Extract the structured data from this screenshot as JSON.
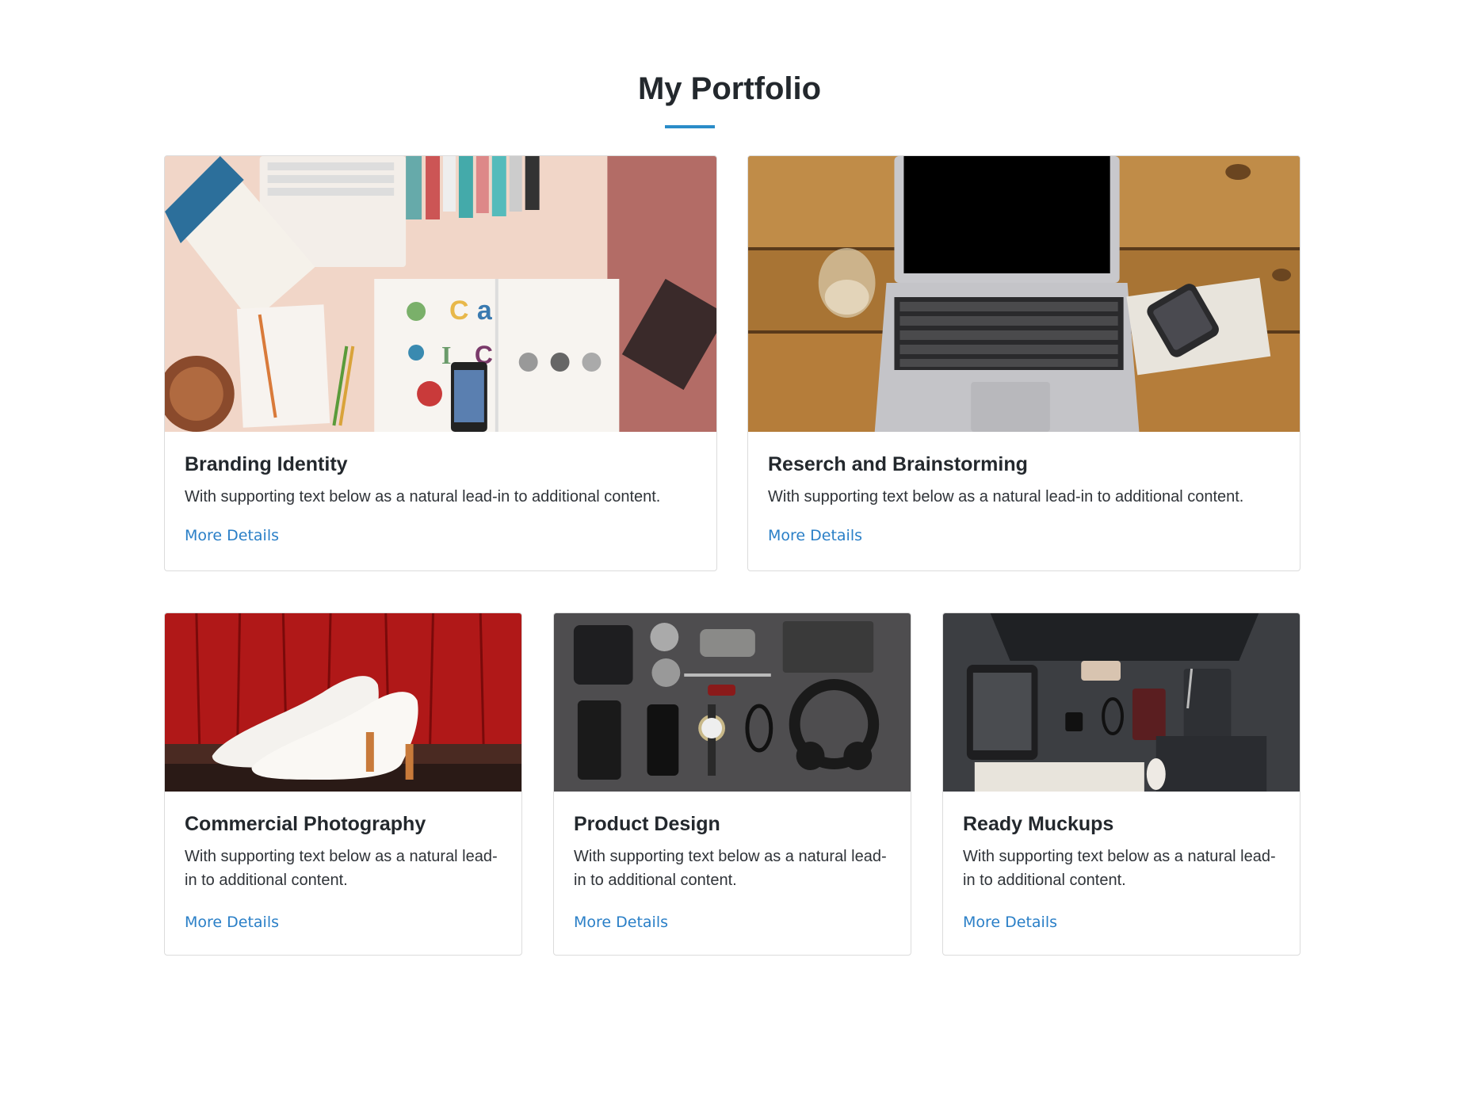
{
  "page": {
    "title": "My Portfolio",
    "accent_color": "#2a8cc8",
    "link_color": "#2a7fc7"
  },
  "cards": [
    {
      "title": "Branding Identity",
      "text": "With supporting text below as a natural lead-in to additional content.",
      "link": "More Details",
      "image": "desk-with-ipod-brochure-and-logo-book"
    },
    {
      "title": "Reserch and Brainstorming",
      "text": "With supporting text below as a natural lead-in to additional content.",
      "link": "More Details",
      "image": "laptop-on-wooden-table-with-glass-and-phone"
    },
    {
      "title": "Commercial Photography",
      "text": "With supporting text below as a natural lead-in to additional content.",
      "link": "More Details",
      "image": "white-heels-against-red-wall"
    },
    {
      "title": "Product Design",
      "text": "With supporting text below as a natural lead-in to additional content.",
      "link": "More Details",
      "image": "flat-lay-accessories-headphones-wallet-watch"
    },
    {
      "title": "Ready Muckups",
      "text": "With supporting text below as a natural lead-in to additional content.",
      "link": "More Details",
      "image": "dark-desk-with-monitor-tablet-keyboard"
    }
  ]
}
